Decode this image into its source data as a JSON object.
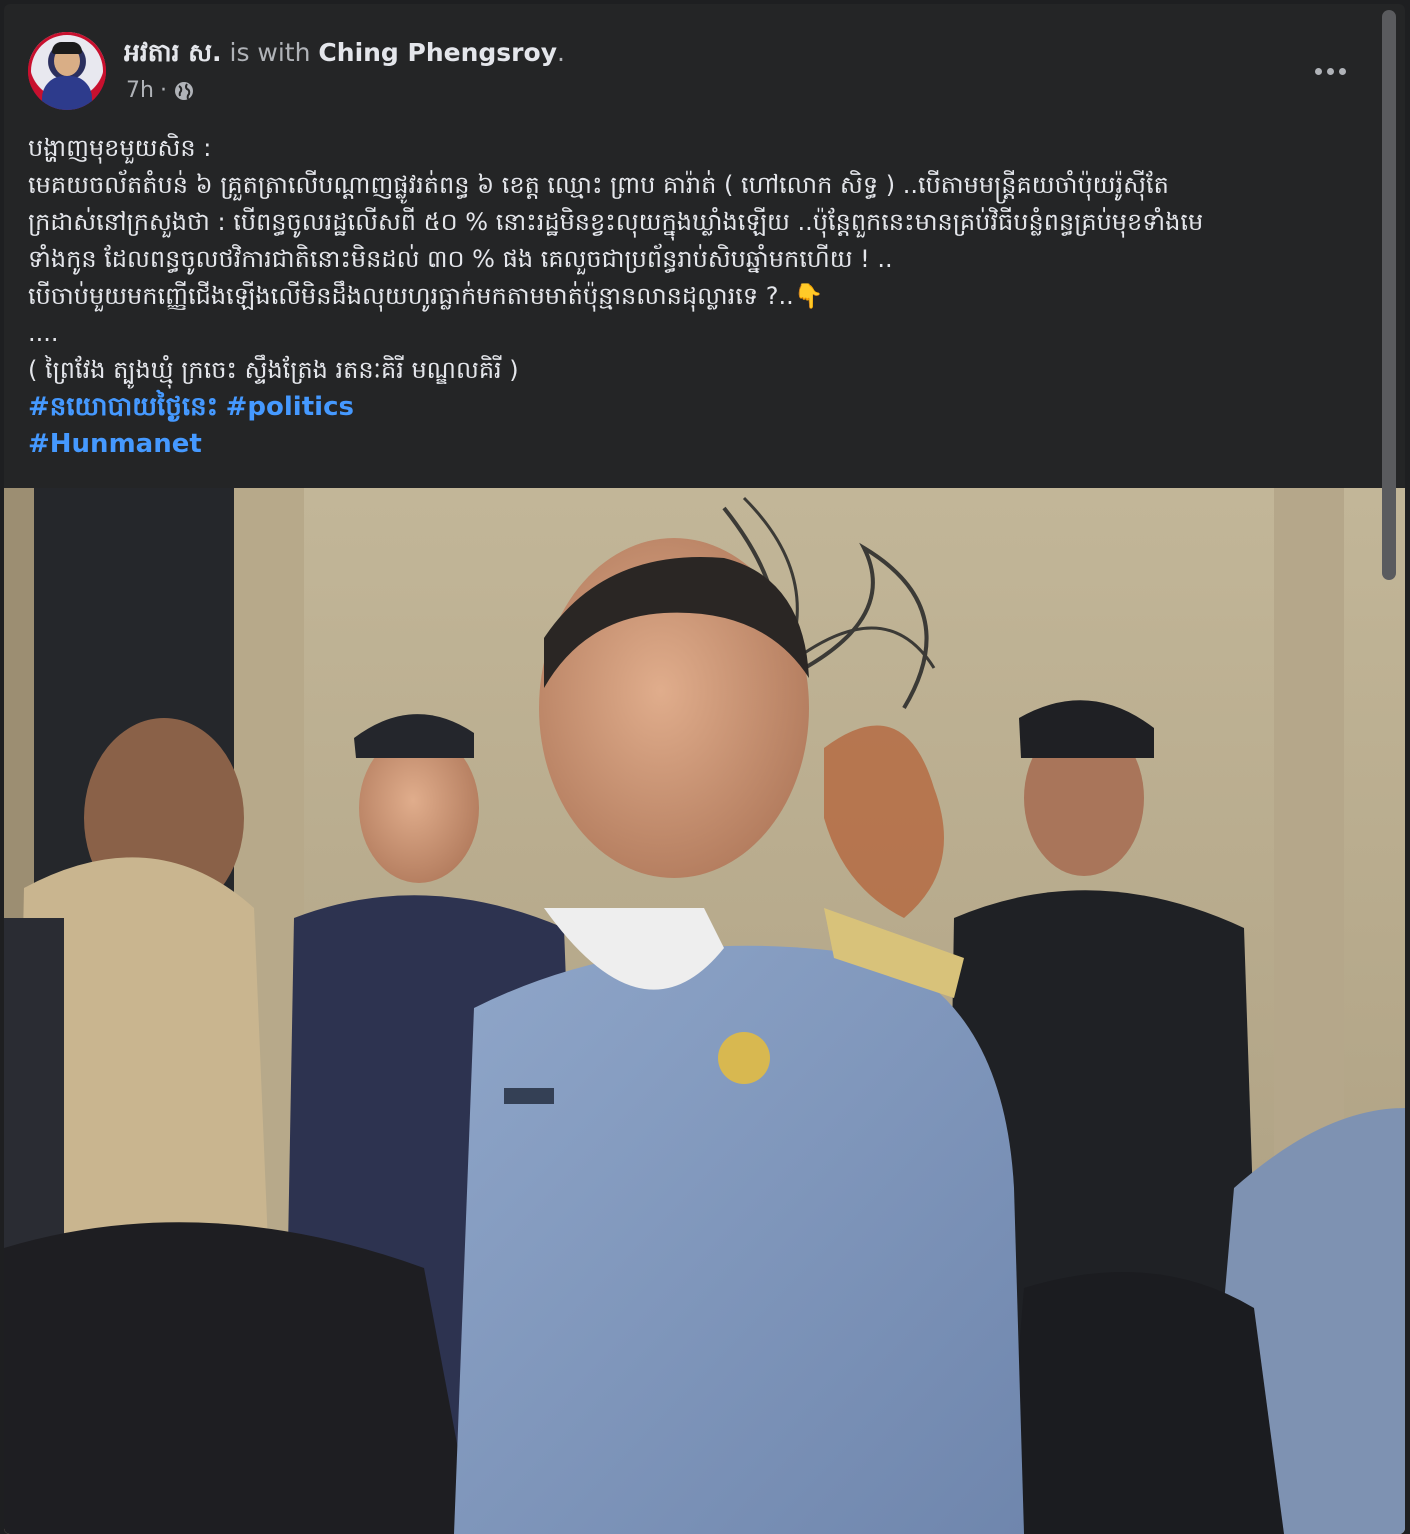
{
  "post": {
    "author": "អវតារ ស.",
    "with_text": "is with",
    "tagged_person": "Ching Phengsroy",
    "trailing_period": ".",
    "time": "7h",
    "separator": "·",
    "audience_icon": "globe-icon",
    "more_icon": "more-options-icon",
    "body_lines": [
      "បង្ហាញមុខមួយសិន :",
      "មេគយចល័តតំបន់ ៦ គ្រួតត្រាលើបណ្ដាញផ្លូវរត់ពន្ធ ៦ ខេត្ត ឈ្មោះ ព្រាប គារ៉ាត់ ( ហៅលោក សិទ្ធ ) ..បើតាមមន្ត្រីគយចាំប៉ុយរ៉ូស៊ីតែ",
      "ក្រដាស់នៅក្រសួងថា : បើពន្ធចូលរដ្ឋលើសពី ៥០ % នោះរដ្ឋមិនខ្វះលុយក្នុងឃ្លាំងឡើយ ..ប៉ុន្តែពួកនេះមានគ្រប់វិធីបន្លំពន្ធគ្រប់មុខទាំងមេ",
      "ទាំងកូន ដែលពន្ធចូលថវិការជាតិនោះមិនដល់ ៣០ % ផង គេលួចជាប្រព័ន្ធរាប់សិបឆ្នាំមកហើយ ! ..",
      "បើចាប់មួយមកញ្ញើជើងឡើងលើមិនដឹងលុយហូរធ្លាក់មកតាមមាត់ប៉ុន្មានលានដុល្លារទេ ?..👇",
      "....",
      "( ព្រៃវែង ត្បូងឃ្មុំ ក្រចេះ ស្ទឹងត្រែង រតនៈគិរី មណ្ឌលគិរី )"
    ],
    "hashtags": [
      "#នយោបាយថ្ងៃនេះ",
      "#politics",
      "#Hunmanet"
    ]
  },
  "colors": {
    "background": "#242526",
    "text": "#e4e6eb",
    "secondary_text": "#b0b3b8",
    "hashtag": "#4599ff"
  }
}
